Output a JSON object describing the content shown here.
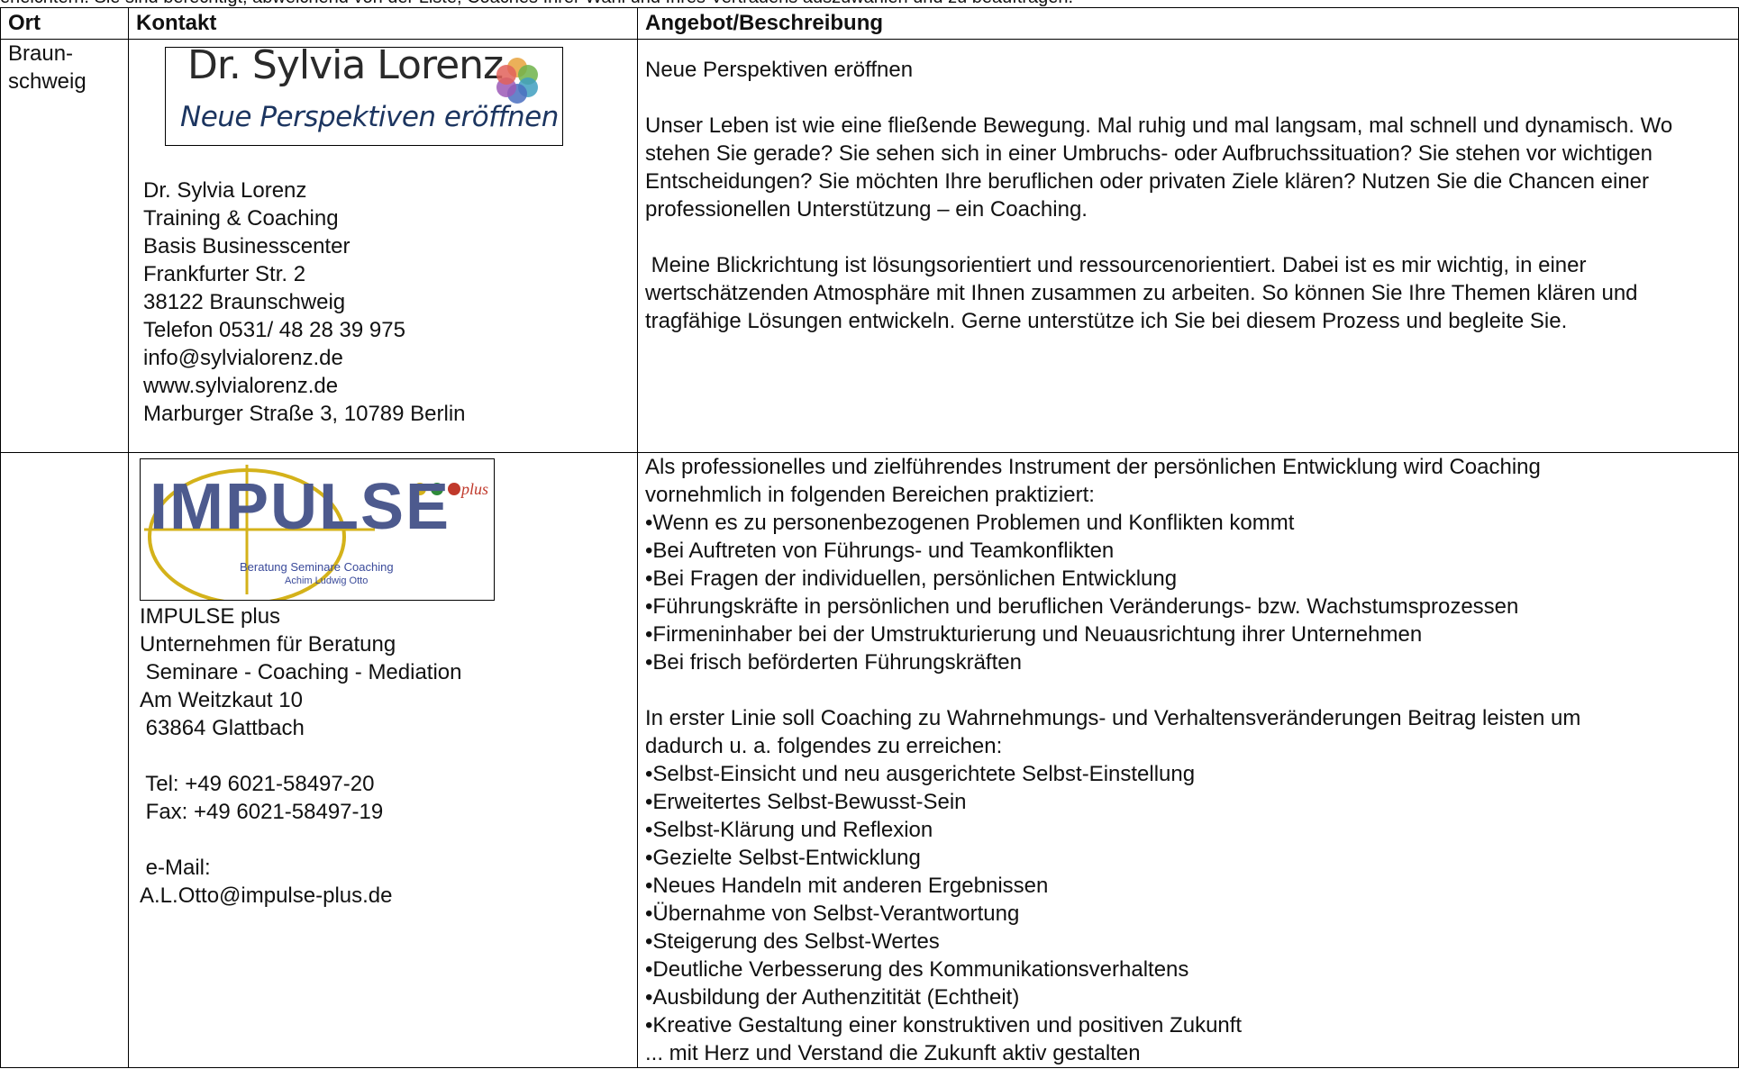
{
  "intro_cut": "erleichtern. Sie sind berechtigt, abweichend von der Liste, Coaches Ihrer Wahl und Ihres Vertrauens auszuwählen und zu beauftragen.",
  "headers": {
    "ort": "Ort",
    "kontakt": "Kontakt",
    "angebot": "Angebot/Beschreibung"
  },
  "row1": {
    "ort_lines": [
      "Braun-",
      "schweig"
    ],
    "logo": {
      "name": "Dr. Sylvia Lorenz",
      "tagline": "Neue Perspektiven eröffnen"
    },
    "contact_lines": [
      "Dr. Sylvia Lorenz",
      "Training & Coaching",
      "Basis Businesscenter",
      "Frankfurter Str. 2",
      "38122 Braunschweig",
      "Telefon 0531/ 48 28 39 975",
      "info@sylvialorenz.de",
      "www.sylvialorenz.de",
      "Marburger Straße 3, 10789 Berlin"
    ],
    "title": "Neue Perspektiven eröffnen",
    "para1": "Unser Leben ist wie eine fließende Bewegung. Mal ruhig und mal langsam, mal schnell und dynamisch. Wo stehen Sie gerade? Sie sehen sich in einer Umbruchs- oder Aufbruchssituation? Sie stehen vor wichtigen Entscheidungen? Sie möchten Ihre beruflichen oder privaten Ziele klären? Nutzen Sie die Chancen einer professionellen Unterstützung – ein Coaching.",
    "para2": " Meine Blickrichtung ist lösungsorientiert und ressourcenorientiert. Dabei ist es mir wichtig, in einer wertschätzenden Atmosphäre mit Ihnen zusammen zu arbeiten. So können Sie Ihre Themen klären und tragfähige Lösungen entwickeln. Gerne unterstütze ich Sie bei diesem Prozess und begleite Sie."
  },
  "row2": {
    "logo": {
      "word": "IMPULSE",
      "plus": "plus",
      "sub1": "Beratung  Seminare  Coaching",
      "sub2": "Achim Ludwig Otto"
    },
    "contact_lines": [
      "IMPULSE plus",
      "Unternehmen für Beratung",
      " Seminare - Coaching - Mediation",
      "Am Weitzkaut 10",
      " 63864 Glattbach",
      "",
      " Tel: +49 6021-58497-20",
      " Fax: +49 6021-58497-19",
      "",
      " e-Mail:",
      "A.L.Otto@impulse-plus.de"
    ],
    "desc_lines_a": [
      "Als professionelles und zielführendes Instrument der persönlichen Entwicklung wird Coaching",
      "vornehmlich in folgenden Bereichen praktiziert:",
      "•Wenn es zu personenbezogenen Problemen und Konflikten kommt",
      "•Bei Auftreten von Führungs- und Teamkonflikten",
      "•Bei Fragen der individuellen, persönlichen Entwicklung",
      "•Führungskräfte in persönlichen und beruflichen Veränderungs- bzw. Wachstumsprozessen",
      "•Firmeninhaber bei der Umstrukturierung und Neuausrichtung ihrer Unternehmen",
      "•Bei frisch beförderten Führungskräften"
    ],
    "desc_lines_b": [
      "In erster Linie soll Coaching zu Wahrnehmungs- und Verhaltensveränderungen Beitrag leisten um",
      "dadurch u. a. folgendes zu erreichen:",
      "•Selbst-Einsicht und neu ausgerichtete Selbst-Einstellung",
      "•Erweitertes Selbst-Bewusst-Sein",
      "•Selbst-Klärung und Reflexion",
      "•Gezielte Selbst-Entwicklung",
      "•Neues Handeln mit anderen Ergebnissen",
      "•Übernahme von Selbst-Verantwortung",
      "•Steigerung des Selbst-Wertes",
      "•Deutliche Verbesserung des Kommunikationsverhaltens",
      "•Ausbildung der Authenzitität (Echtheit)",
      "•Kreative Gestaltung einer konstruktiven und positiven Zukunft",
      "... mit Herz und Verstand die Zukunft aktiv gestalten"
    ]
  }
}
